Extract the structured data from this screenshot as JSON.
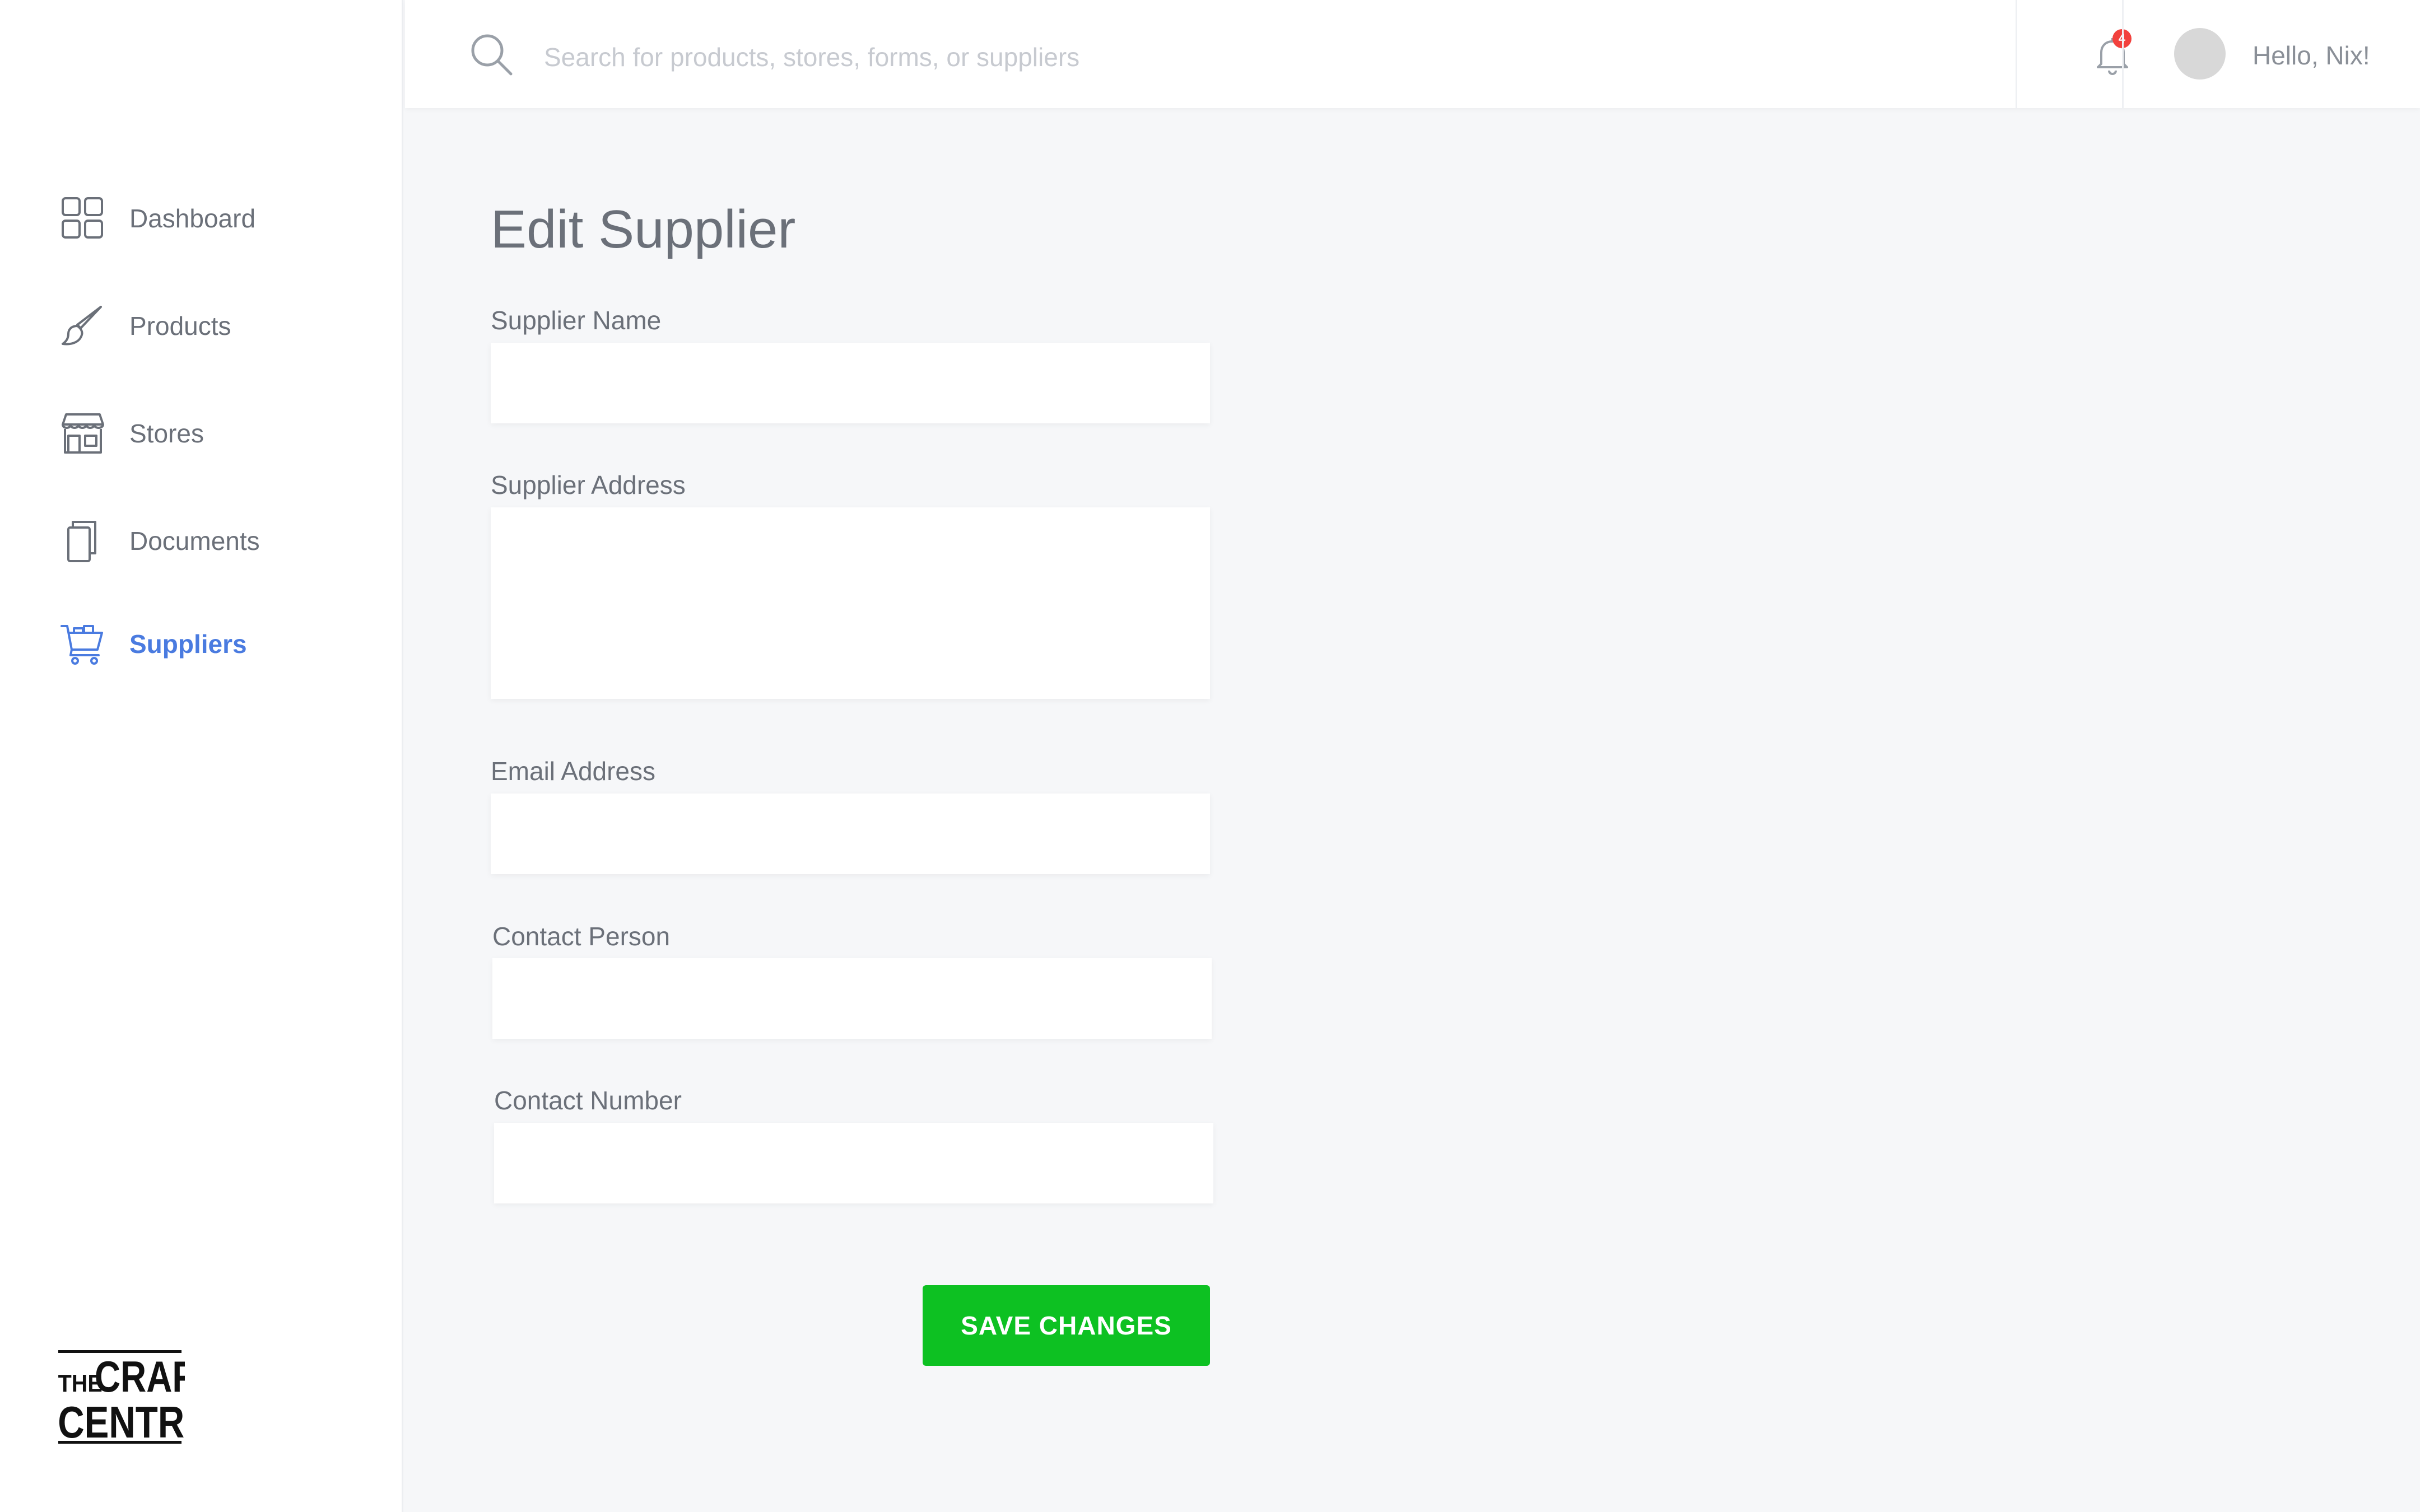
{
  "header": {
    "search_placeholder": "Search for products, stores, forms, or suppliers",
    "notification_count": "4",
    "greeting": "Hello, Nix!"
  },
  "sidebar": {
    "items": [
      {
        "label": "Dashboard",
        "icon": "dashboard-grid-icon",
        "active": false
      },
      {
        "label": "Products",
        "icon": "paintbrush-icon",
        "active": false
      },
      {
        "label": "Stores",
        "icon": "storefront-icon",
        "active": false
      },
      {
        "label": "Documents",
        "icon": "documents-icon",
        "active": false
      },
      {
        "label": "Suppliers",
        "icon": "shopping-cart-icon",
        "active": true
      }
    ],
    "logo": {
      "line1_small": "THE",
      "line1_big": "CRAFT",
      "line2": "CENTRAL"
    }
  },
  "main": {
    "title": "Edit Supplier",
    "fields": {
      "supplier_name": {
        "label": "Supplier Name",
        "value": ""
      },
      "supplier_address": {
        "label": "Supplier Address",
        "value": ""
      },
      "email_address": {
        "label": "Email Address",
        "value": ""
      },
      "contact_person": {
        "label": "Contact Person",
        "value": ""
      },
      "contact_number": {
        "label": "Contact Number",
        "value": ""
      }
    },
    "save_label": "SAVE CHANGES"
  },
  "colors": {
    "accent": "#4a7be0",
    "save_button": "#0dc122",
    "badge": "#f2413d",
    "background": "#f6f7f9"
  }
}
